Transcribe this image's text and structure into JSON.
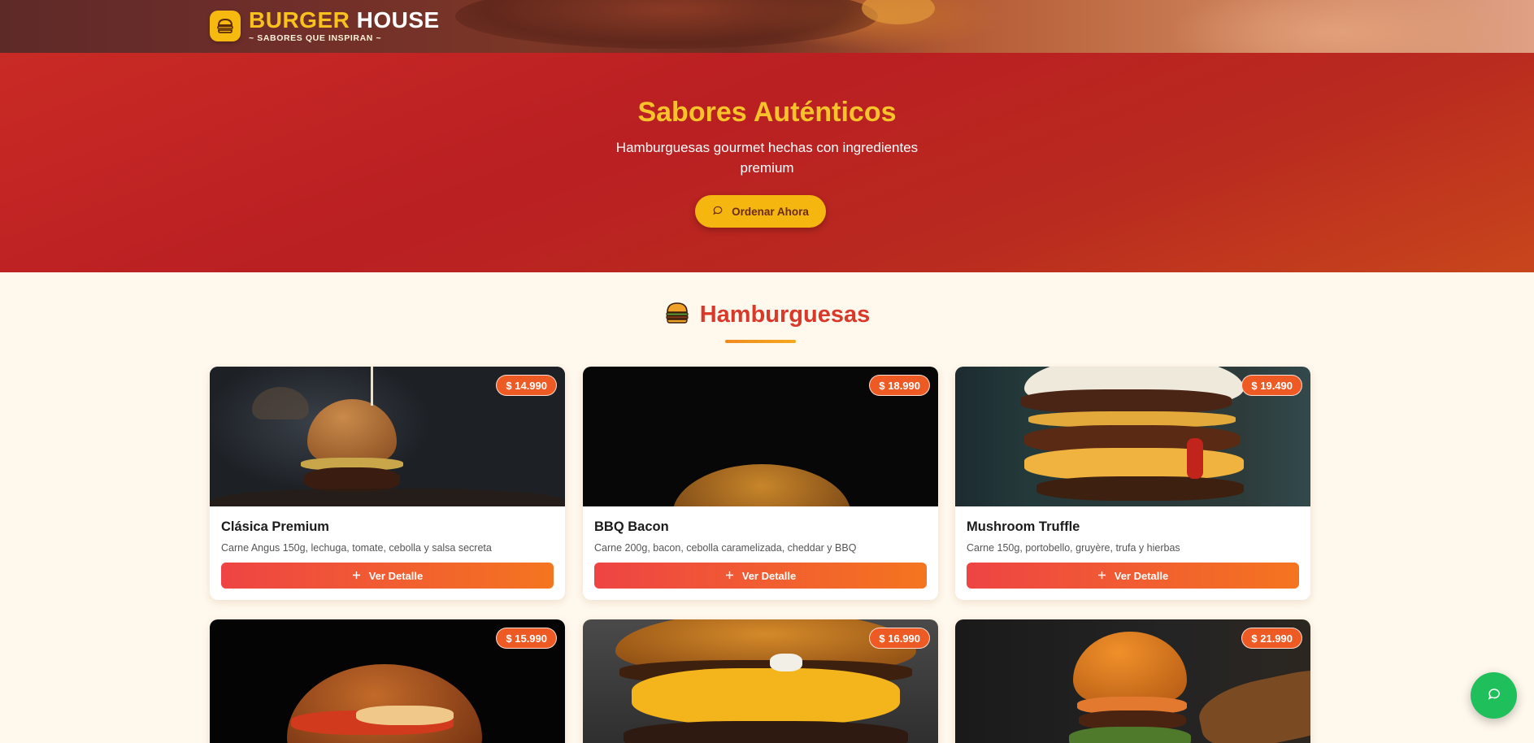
{
  "header": {
    "brand_word1": "BURGER",
    "brand_word2": "HOUSE",
    "tagline": "~ SABORES QUE INSPIRAN ~",
    "logo_icon": "burger-icon"
  },
  "hero": {
    "title": "Sabores Auténticos",
    "subtitle": "Hamburguesas gourmet hechas con ingredientes premium",
    "cta_label": "Ordenar Ahora",
    "cta_icon": "chat-bubble-icon"
  },
  "section": {
    "title": "Hamburguesas",
    "icon": "burger-icon"
  },
  "products": [
    {
      "name": "Clásica Premium",
      "description": "Carne Angus 150g, lechuga, tomate, cebolla y salsa secreta",
      "price": "$ 14.990",
      "button_label": "Ver Detalle"
    },
    {
      "name": "BBQ Bacon",
      "description": "Carne 200g, bacon, cebolla caramelizada, cheddar y BBQ",
      "price": "$ 18.990",
      "button_label": "Ver Detalle"
    },
    {
      "name": "Mushroom Truffle",
      "description": "Carne 150g, portobello, gruyère, trufa y hierbas",
      "price": "$ 19.490",
      "button_label": "Ver Detalle"
    },
    {
      "price": "$ 15.990"
    },
    {
      "price": "$ 16.990"
    },
    {
      "price": "$ 21.990"
    }
  ],
  "colors": {
    "brand_yellow": "#f7c21d",
    "hero_red": "#ba1f22",
    "accent_orange": "#ee5a24",
    "whatsapp_green": "#1fbf5c",
    "page_bg": "#fff8ec"
  },
  "chat_fab_icon": "chat-bubble-icon"
}
